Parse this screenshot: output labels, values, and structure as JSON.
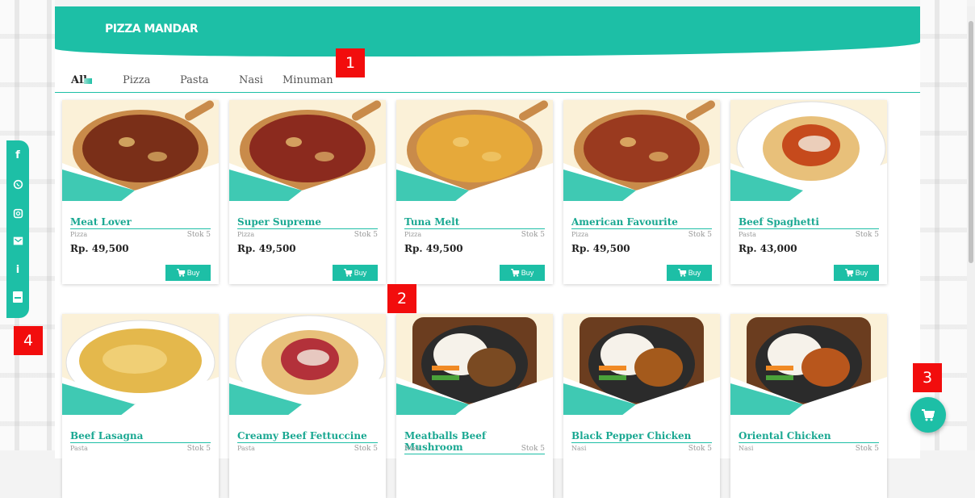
{
  "brand": "PIZZA MANDAR",
  "tabs": [
    "All",
    "Pizza",
    "Pasta",
    "Nasi",
    "Minuman"
  ],
  "buy_label": "Buy",
  "products": [
    {
      "name": "Meat Lover",
      "category": "Pizza",
      "stock": "Stok 5",
      "price": "Rp. 49,500",
      "kind": "pizza",
      "topping": "#7a2f18"
    },
    {
      "name": "Super Supreme",
      "category": "Pizza",
      "stock": "Stok 5",
      "price": "Rp. 49,500",
      "kind": "pizza",
      "topping": "#8b2a1e"
    },
    {
      "name": "Tuna Melt",
      "category": "Pizza",
      "stock": "Stok 5",
      "price": "Rp. 49,500",
      "kind": "pizza",
      "topping": "#e6a93a"
    },
    {
      "name": "American Favourite",
      "category": "Pizza",
      "stock": "Stok 5",
      "price": "Rp. 49,500",
      "kind": "pizza",
      "topping": "#9a3a1f"
    },
    {
      "name": "Beef Spaghetti",
      "category": "Pasta",
      "stock": "Stok 5",
      "price": "Rp. 43,000",
      "kind": "pasta",
      "topping": "#c64a1c"
    },
    {
      "name": "Beef Lasagna",
      "category": "Pasta",
      "stock": "Stok 5",
      "price": "",
      "kind": "lasagna",
      "topping": "#e4b84c"
    },
    {
      "name": "Creamy Beef Fettuccine",
      "category": "Pasta",
      "stock": "Stok 5",
      "price": "",
      "kind": "pasta",
      "topping": "#b3313a"
    },
    {
      "name": "Meatballs Beef Mushroom",
      "category": "Nasi",
      "stock": "Stok 5",
      "price": "",
      "kind": "nasi",
      "topping": "#7a4a22"
    },
    {
      "name": "Black Pepper Chicken",
      "category": "Nasi",
      "stock": "Stok 5",
      "price": "",
      "kind": "nasi",
      "topping": "#a45a1c"
    },
    {
      "name": "Oriental Chicken",
      "category": "Nasi",
      "stock": "Stok 5",
      "price": "",
      "kind": "nasi",
      "topping": "#b8561c"
    }
  ],
  "social_icons": [
    "facebook-icon",
    "whatsapp-icon",
    "instagram-icon",
    "email-icon",
    "info-icon",
    "menu-book-icon"
  ],
  "markers": [
    "1",
    "2",
    "3",
    "4"
  ],
  "colors": {
    "accent": "#1dbfa6",
    "marker": "#f20d0d"
  }
}
